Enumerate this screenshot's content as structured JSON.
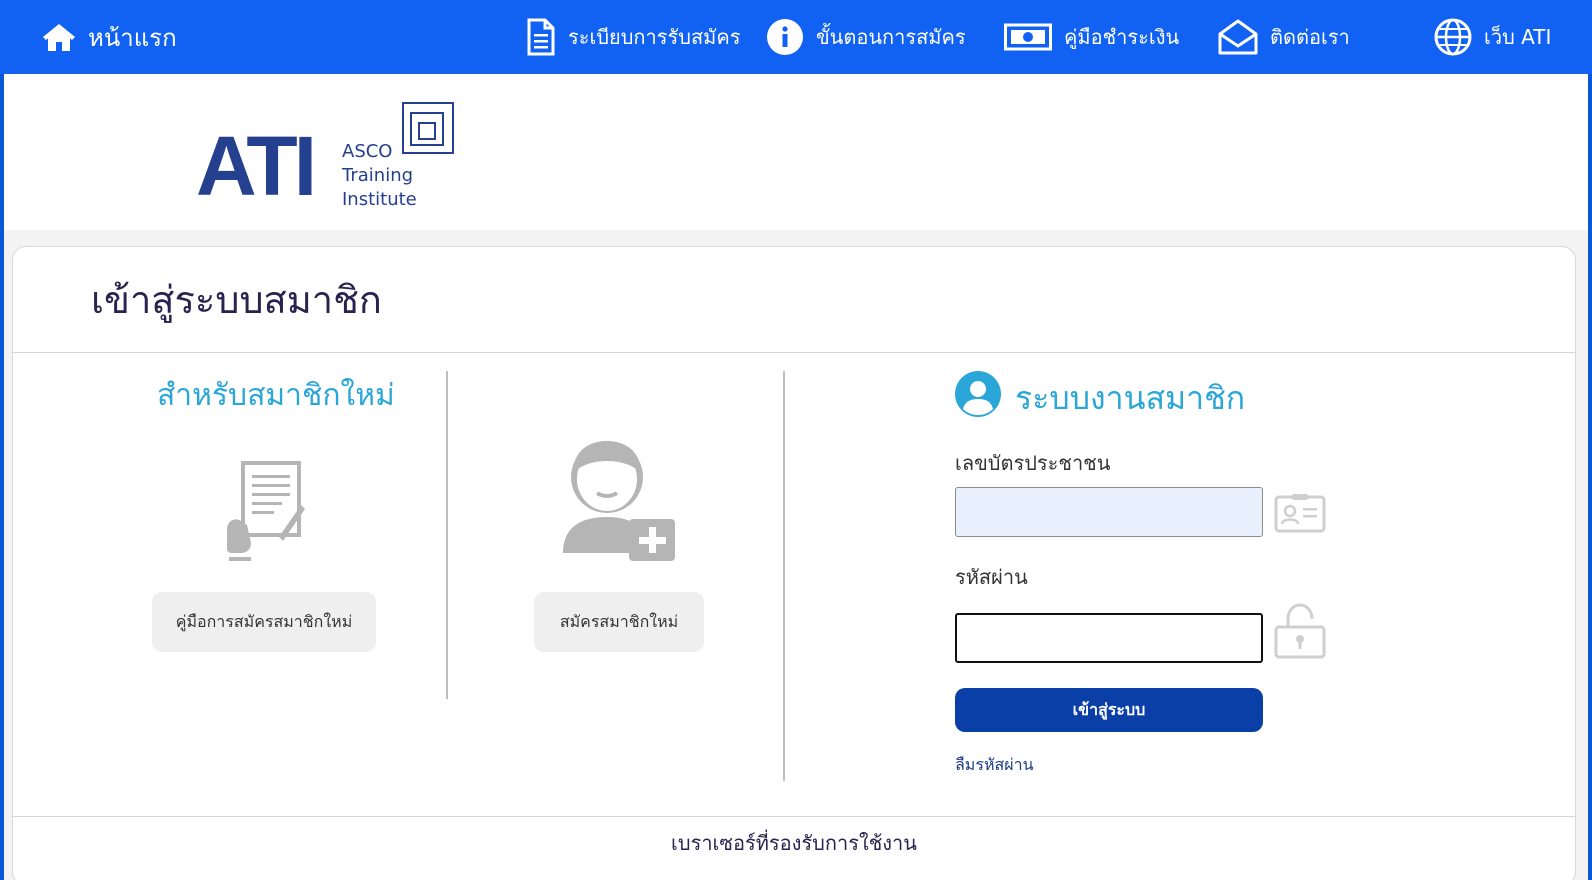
{
  "nav": {
    "home": "หน้าแรก",
    "rules": "ระเบียบการรับสมัคร",
    "steps": "ขั้นตอนการสมัคร",
    "payment": "คู่มือชำระเงิน",
    "contact": "ติดต่อเรา",
    "website": "เว็บ ATI"
  },
  "logo": {
    "mark": "ATI",
    "line1": "ASCO",
    "line2": "Training",
    "line3": "Institute"
  },
  "page": {
    "title": "เข้าสู่ระบบสมาชิก",
    "footer_text": "เบราเซอร์ที่รองรับการใช้งาน"
  },
  "new_member": {
    "heading": "สำหรับสมาชิกใหม่",
    "guide_button": "คู่มือการสมัครสมาชิกใหม่",
    "register_button": "สมัครสมาชิกใหม่"
  },
  "login": {
    "heading": "ระบบงานสมาชิก",
    "id_label": "เลขบัตรประชาชน",
    "id_value": "",
    "password_label": "รหัสผ่าน",
    "password_value": "",
    "submit": "เข้าสู่ระบบ",
    "forgot": "ลืมรหัสผ่าน"
  },
  "colors": {
    "nav_bg": "#1162f2",
    "accent": "#2aa6d8",
    "button_primary": "#0a3fa8",
    "logo": "#25408f"
  }
}
